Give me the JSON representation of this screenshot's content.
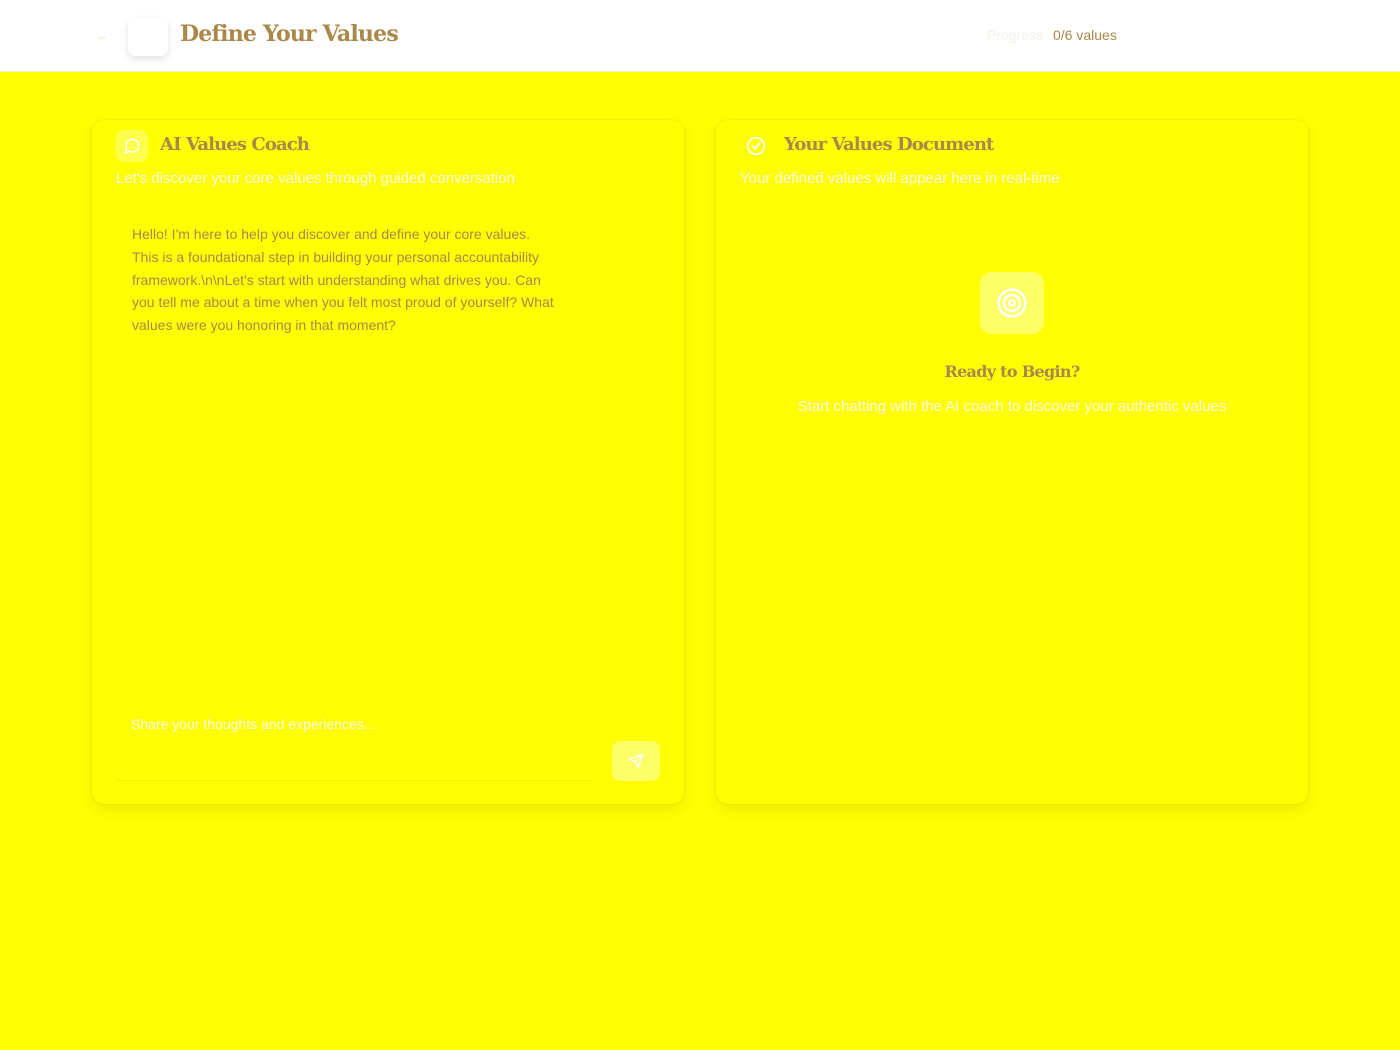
{
  "header": {
    "title": "Define Your Values",
    "progress_label": "Progress",
    "progress_count": "0/6 values"
  },
  "coach": {
    "title": "AI Values Coach",
    "subtitle": "Let's discover your core values through guided conversation",
    "message": "Hello! I'm here to help you discover and define your core values. This is a foundational step in building your personal accountability framework.\\n\\nLet's start with understanding what drives you. Can you tell me about a time when you felt most proud of yourself? What values were you honoring in that moment?",
    "input_placeholder": "Share your thoughts and experiences..."
  },
  "document": {
    "title": "Your Values Document",
    "subtitle": "Your defined values will appear here in real-time",
    "empty_title": "Ready to Begin?",
    "empty_subtitle": "Start chatting with the AI coach to discover your authentic values"
  },
  "icons": {
    "back": "arrow-left-icon",
    "coach": "chat-bubble-icon",
    "document": "check-circle-icon",
    "send": "send-icon",
    "empty": "target-icon"
  },
  "colors": {
    "background": "#ffff00",
    "accent": "#a8894a",
    "muted_text": "#fffbea"
  }
}
